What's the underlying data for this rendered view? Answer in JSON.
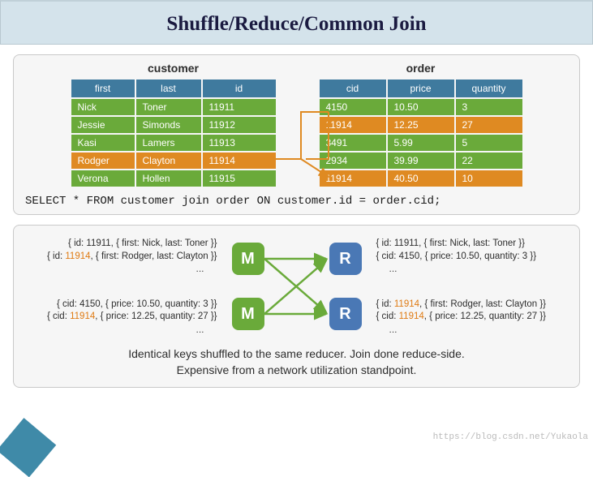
{
  "title": "Shuffle/Reduce/Common Join",
  "customer": {
    "title": "customer",
    "headers": [
      "first",
      "last",
      "id"
    ],
    "rows": [
      {
        "first": "Nick",
        "last": "Toner",
        "id": "11911",
        "hl": false
      },
      {
        "first": "Jessie",
        "last": "Simonds",
        "id": "11912",
        "hl": false
      },
      {
        "first": "Kasi",
        "last": "Lamers",
        "id": "11913",
        "hl": false
      },
      {
        "first": "Rodger",
        "last": "Clayton",
        "id": "11914",
        "hl": true
      },
      {
        "first": "Verona",
        "last": "Hollen",
        "id": "11915",
        "hl": false
      }
    ]
  },
  "order": {
    "title": "order",
    "headers": [
      "cid",
      "price",
      "quantity"
    ],
    "rows": [
      {
        "cid": "4150",
        "price": "10.50",
        "quantity": "3",
        "hl": false
      },
      {
        "cid": "11914",
        "price": "12.25",
        "quantity": "27",
        "hl": true
      },
      {
        "cid": "3491",
        "price": "5.99",
        "quantity": "5",
        "hl": false
      },
      {
        "cid": "2934",
        "price": "39.99",
        "quantity": "22",
        "hl": false
      },
      {
        "cid": "11914",
        "price": "40.50",
        "quantity": "10",
        "hl": true
      }
    ]
  },
  "sql": "SELECT * FROM customer join order ON customer.id = order.cid;",
  "mapreduce": {
    "m_label": "M",
    "r_label": "R",
    "left_top": [
      "{ id: 11911, { first: Nick, last: Toner }}",
      "{ id: |11914|, { first: Rodger, last: Clayton }}"
    ],
    "left_bottom": [
      "{ cid: 4150, { price: 10.50, quantity: 3 }}",
      "{ cid: |11914|, { price: 12.25, quantity: 27 }}"
    ],
    "right_top": [
      "{ id: 11911, { first: Nick, last: Toner }}",
      "{ cid: 4150, { price: 10.50, quantity: 3 }}"
    ],
    "right_bottom": [
      "{ id: |11914|, { first: Rodger, last: Clayton }}",
      "{ cid: |11914|, { price: 12.25, quantity: 27 }}"
    ]
  },
  "caption_line1": "Identical keys shuffled to the same reducer. Join done reduce-side.",
  "caption_line2": "Expensive from a network utilization standpoint.",
  "watermark": "https://blog.csdn.net/Yukaola"
}
